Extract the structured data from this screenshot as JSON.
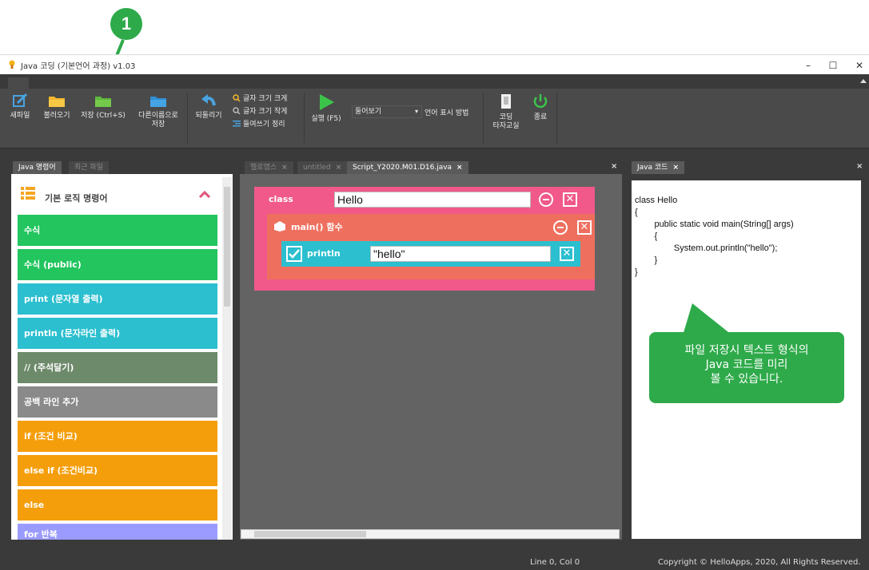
{
  "annotation": {
    "marker_number": "1",
    "callout_text_lines": [
      "파일 저장시 텍스트 형식의",
      "Java 코드를 미리",
      "볼 수 있습니다."
    ]
  },
  "window": {
    "title": "Java 코딩 (기본언어 과정) v1.03",
    "minimize": "–",
    "maximize": "☐",
    "close": "✕"
  },
  "toolbar": {
    "new": "새파일",
    "open": "불러오기",
    "save": "저장 (Ctrl+S)",
    "save_as_line1": "다른이름으로",
    "save_as_line2": "저장",
    "undo": "되돌리기",
    "font_bigger": "글자 크기 크게",
    "font_smaller": "글자 크기 작게",
    "indent": "들여쓰기 정리",
    "run": "실행 (F5)",
    "view_select": "둘어보기",
    "language_display": "언어 표시 방법",
    "coding_class_line1": "코딩",
    "coding_class_line2": "타자교실",
    "exit": "종료"
  },
  "left_panel": {
    "tabs": [
      "Java 명령어",
      "최근 파일"
    ],
    "section_title": "기본 로직 명령어",
    "commands": [
      {
        "label": "수식",
        "color": "#22c55e"
      },
      {
        "label": "수식 (public)",
        "color": "#22c55e"
      },
      {
        "label": "print (문자열 출력)",
        "color": "#2bbfcf"
      },
      {
        "label": "println (문자라인 출력)",
        "color": "#2bbfcf"
      },
      {
        "label": "// (주석달기)",
        "color": "#6d8a6a"
      },
      {
        "label": "공백 라인 추가",
        "color": "#8a8a8a"
      },
      {
        "label": "if (조건 비교)",
        "color": "#f59e0b"
      },
      {
        "label": "else if (조건비교)",
        "color": "#f59e0b"
      },
      {
        "label": "else",
        "color": "#f59e0b"
      },
      {
        "label": "for 반복",
        "color": "#9b9bff"
      }
    ]
  },
  "editor": {
    "tabs": [
      {
        "label": "헬로앱스",
        "close": "×"
      },
      {
        "label": "untitled",
        "close": "×"
      },
      {
        "label": "Script_Y2020.M01.D16.java",
        "close": "×"
      }
    ],
    "panel_close": "×",
    "class_block": {
      "label": "class",
      "value": "Hello",
      "color": "#f0598a"
    },
    "main_block": {
      "label": "main() 함수",
      "color": "#ef6f5e"
    },
    "println_block": {
      "label": "println",
      "value": "\"hello\"",
      "color": "#2bbfcf"
    }
  },
  "code_panel": {
    "tab": "Java 코드",
    "tab_close": "×",
    "panel_close": "×",
    "code": "class Hello\n{\n        public static void main(String[] args)\n        {\n                System.out.println(\"hello\");\n        }\n}"
  },
  "status_bar": {
    "position": "Line 0, Col 0",
    "copyright": "Copyright © HelloApps, 2020, All Rights Reserved."
  }
}
